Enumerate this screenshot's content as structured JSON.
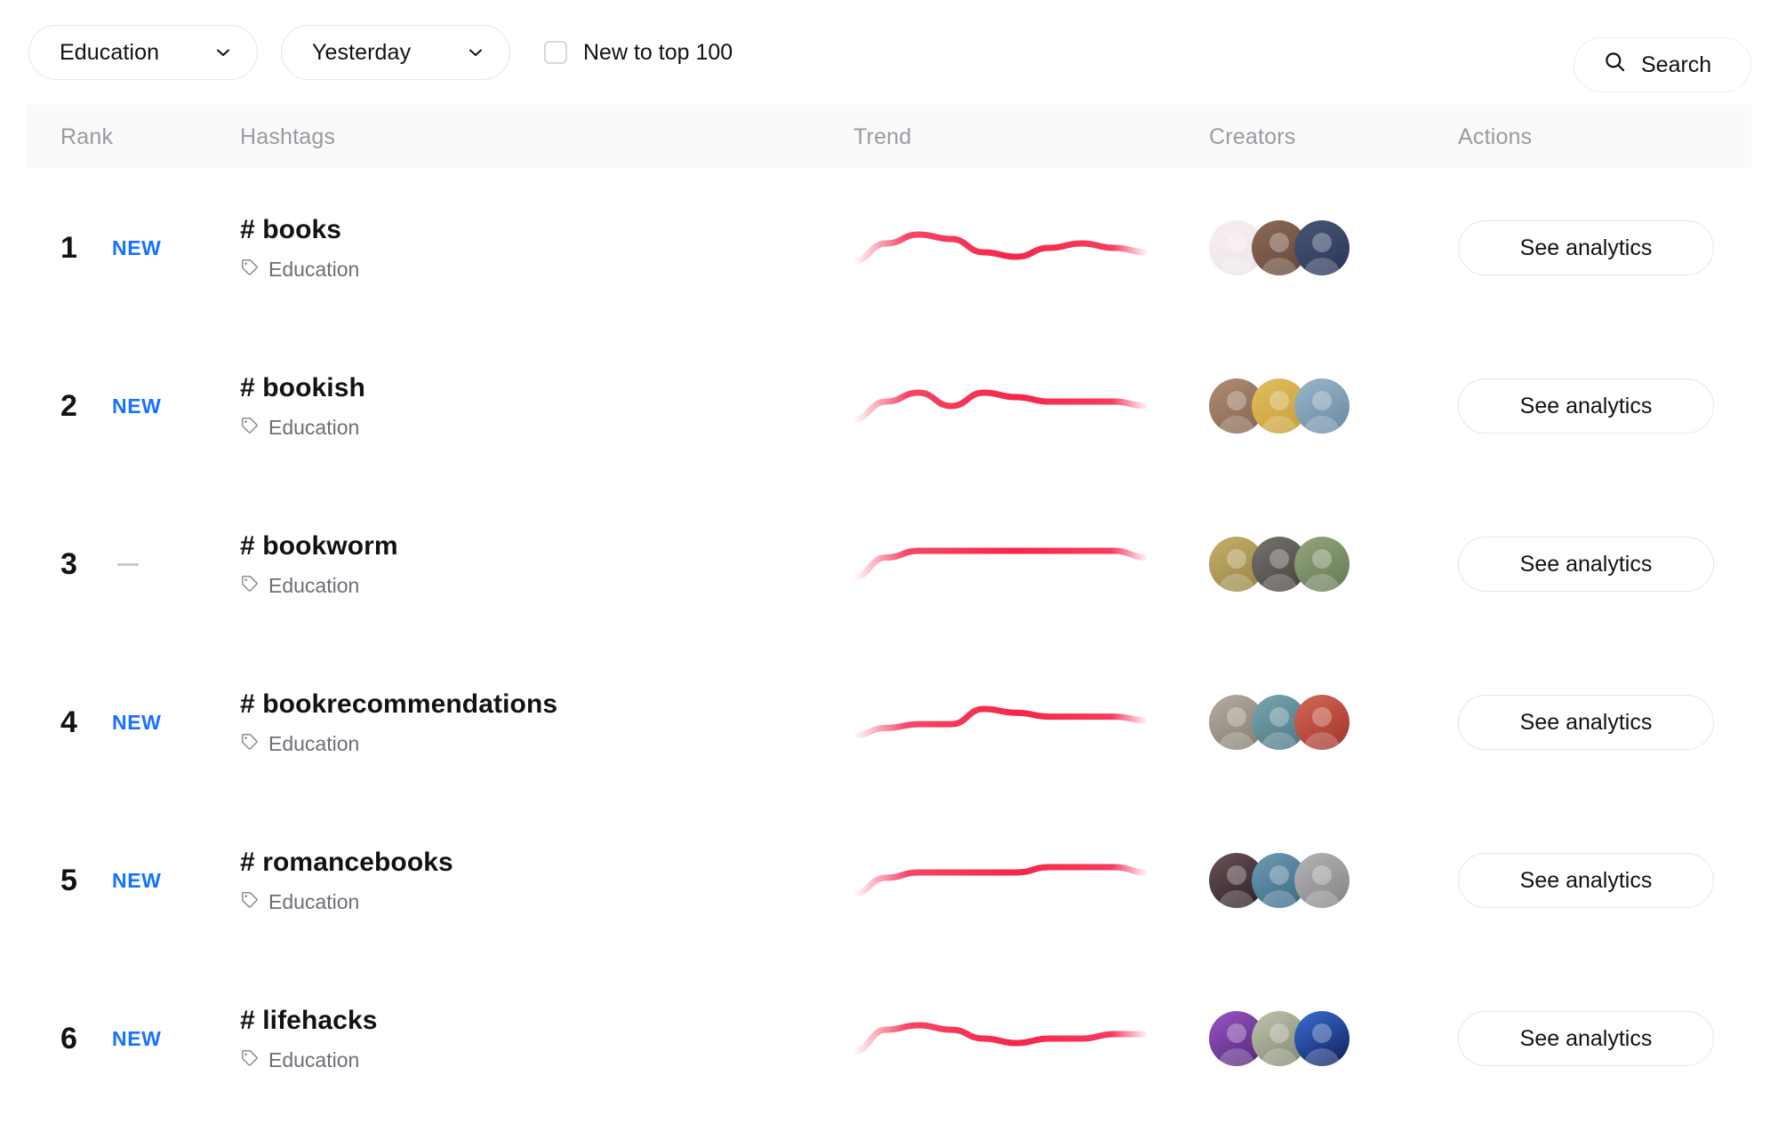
{
  "filters": {
    "category_select": {
      "value": "Education",
      "icon": "chevron-down-icon"
    },
    "period_select": {
      "value": "Yesterday",
      "icon": "chevron-down-icon"
    },
    "new_to_top_checkbox": {
      "label": "New to top 100",
      "checked": false
    },
    "search_button": {
      "label": "Search",
      "icon": "search-icon"
    }
  },
  "table": {
    "headers": {
      "rank": "Rank",
      "hashtags": "Hashtags",
      "trend": "Trend",
      "creators": "Creators",
      "actions": "Actions"
    },
    "action_label": "See analytics",
    "rows": [
      {
        "rank": "1",
        "badge": "NEW",
        "badge_type": "new",
        "hashtag": "# books",
        "category": "Education",
        "category_icon": "tag-icon",
        "creator_colors": [
          "#efe6ea",
          "#6b4b3e",
          "#2e3a5c"
        ],
        "creator_colors2": [
          "#f6eef1",
          "#8b6a55",
          "#4a5675"
        ],
        "trend_points": [
          0,
          4,
          6,
          5,
          2,
          1,
          3,
          4,
          3,
          2
        ],
        "analytics_label": "See analytics"
      },
      {
        "rank": "2",
        "badge": "NEW",
        "badge_type": "new",
        "hashtag": "# bookish",
        "category": "Education",
        "category_icon": "tag-icon",
        "creator_colors": [
          "#8a6a55",
          "#caa23a",
          "#6f8fa8"
        ],
        "creator_colors2": [
          "#b08c72",
          "#e0c060",
          "#9bb6c8"
        ],
        "trend_points": [
          0,
          4,
          6,
          3,
          6,
          5,
          4,
          4,
          4,
          3
        ],
        "analytics_label": "See analytics"
      },
      {
        "rank": "3",
        "badge": "—",
        "badge_type": "flat",
        "hashtag": "# bookworm",
        "category": "Education",
        "category_icon": "tag-icon",
        "creator_colors": [
          "#9d8a4a",
          "#4d4a46",
          "#6c7f5a"
        ],
        "creator_colors2": [
          "#c4b06a",
          "#77726c",
          "#93a67c"
        ],
        "trend_points": [
          0,
          3,
          4,
          4,
          4,
          4,
          4,
          4,
          4,
          3
        ],
        "analytics_label": "See analytics"
      },
      {
        "rank": "4",
        "badge": "NEW",
        "badge_type": "new",
        "hashtag": "# bookrecommendations",
        "category": "Education",
        "category_icon": "tag-icon",
        "creator_colors": [
          "#8c8378",
          "#4f7c88",
          "#a83a2f"
        ],
        "creator_colors2": [
          "#b5aca0",
          "#7aa6b2",
          "#d4695a"
        ],
        "trend_points": [
          0,
          2,
          3,
          3,
          7,
          6,
          5,
          5,
          5,
          4
        ],
        "analytics_label": "See analytics"
      },
      {
        "rank": "5",
        "badge": "NEW",
        "badge_type": "new",
        "hashtag": "# romancebooks",
        "category": "Education",
        "category_icon": "tag-icon",
        "creator_colors": [
          "#33272a",
          "#3f6f8a",
          "#8a8a8c"
        ],
        "creator_colors2": [
          "#6b5257",
          "#6f9bb4",
          "#b5b5b8"
        ],
        "trend_points": [
          0,
          3,
          4,
          4,
          4,
          4,
          5,
          5,
          5,
          4
        ],
        "analytics_label": "See analytics"
      },
      {
        "rank": "6",
        "badge": "NEW",
        "badge_type": "new",
        "hashtag": "# lifehacks",
        "category": "Education",
        "category_icon": "tag-icon",
        "creator_colors": [
          "#5b2d82",
          "#8a8f7a",
          "#142a6b"
        ],
        "creator_colors2": [
          "#9a55c4",
          "#bfc4ad",
          "#3b6fd4"
        ],
        "trend_points": [
          0,
          5,
          6,
          5,
          3,
          2,
          3,
          3,
          4,
          4
        ],
        "analytics_label": "See analytics"
      }
    ]
  },
  "colors": {
    "accent_blue": "#1673ff",
    "trend_line": "#f5264b",
    "header_bg": "#fafafa",
    "muted_text": "#9a9aa2"
  }
}
